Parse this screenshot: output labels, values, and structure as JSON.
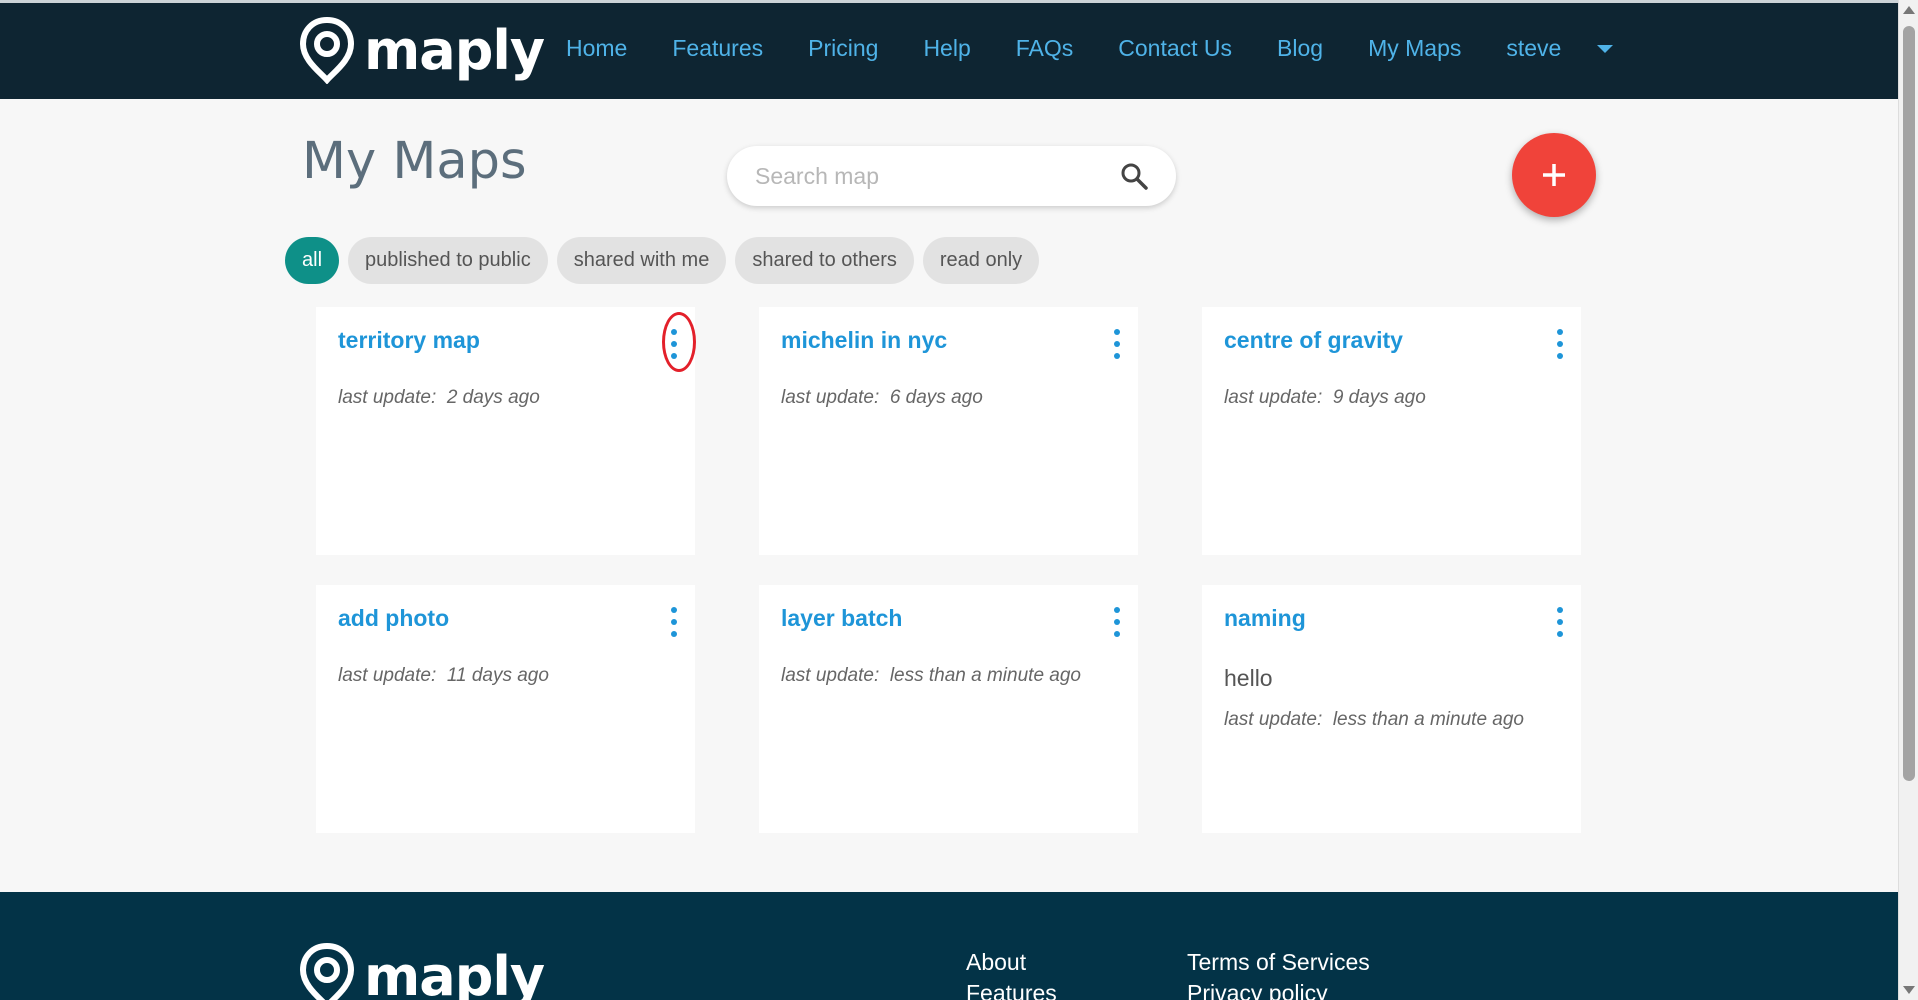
{
  "header": {
    "logo_text": "maply",
    "nav": [
      "Home",
      "Features",
      "Pricing",
      "Help",
      "FAQs",
      "Contact Us",
      "Blog",
      "My Maps"
    ],
    "user": "steve"
  },
  "page": {
    "title": "My Maps",
    "search_placeholder": "Search map"
  },
  "filters": [
    "all",
    "published to public",
    "shared with me",
    "shared to others",
    "read only"
  ],
  "update_label": "last update:",
  "cards": [
    {
      "title": "territory map",
      "desc": "",
      "updated": "2 days ago"
    },
    {
      "title": "michelin in nyc",
      "desc": "",
      "updated": "6 days ago"
    },
    {
      "title": "centre of gravity",
      "desc": "",
      "updated": "9 days ago"
    },
    {
      "title": "add photo",
      "desc": "",
      "updated": "11 days ago"
    },
    {
      "title": "layer batch",
      "desc": "",
      "updated": "less than a minute ago"
    },
    {
      "title": "naming",
      "desc": "hello",
      "updated": "less than a minute ago"
    }
  ],
  "footer": {
    "logo_text": "maply",
    "links_col1": [
      "About",
      "Features"
    ],
    "links_col2": [
      "Terms of Services",
      "Privacy policy"
    ]
  },
  "colors": {
    "header_bg": "#0e2532",
    "nav_link": "#4fb3e8",
    "accent_teal": "#0e9088",
    "fab_red": "#f0433a",
    "card_title": "#1e95d8",
    "footer_bg": "#033347",
    "highlight": "#e3202a"
  }
}
